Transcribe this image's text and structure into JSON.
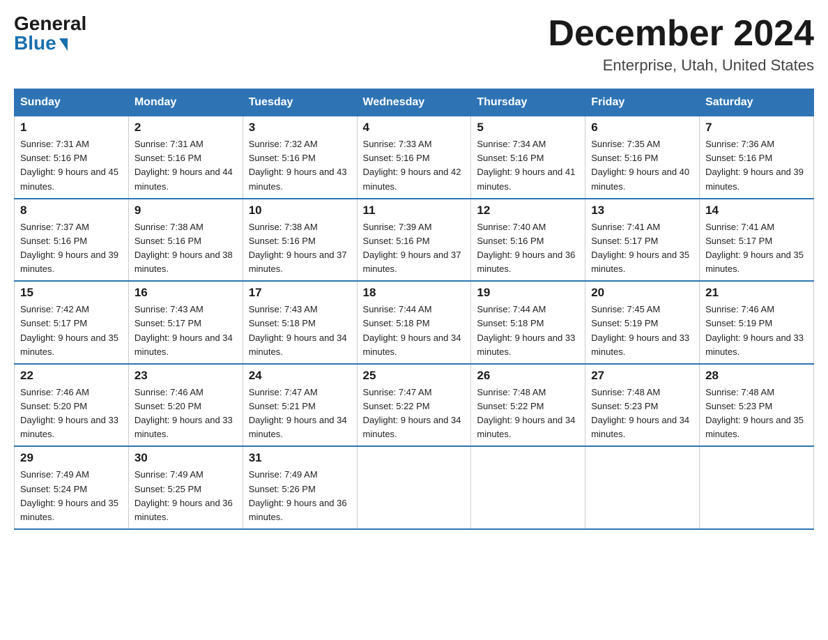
{
  "logo": {
    "general": "General",
    "blue": "Blue"
  },
  "title": "December 2024",
  "location": "Enterprise, Utah, United States",
  "days_of_week": [
    "Sunday",
    "Monday",
    "Tuesday",
    "Wednesday",
    "Thursday",
    "Friday",
    "Saturday"
  ],
  "weeks": [
    [
      {
        "day": 1,
        "sunrise": "7:31 AM",
        "sunset": "5:16 PM",
        "daylight": "9 hours and 45 minutes."
      },
      {
        "day": 2,
        "sunrise": "7:31 AM",
        "sunset": "5:16 PM",
        "daylight": "9 hours and 44 minutes."
      },
      {
        "day": 3,
        "sunrise": "7:32 AM",
        "sunset": "5:16 PM",
        "daylight": "9 hours and 43 minutes."
      },
      {
        "day": 4,
        "sunrise": "7:33 AM",
        "sunset": "5:16 PM",
        "daylight": "9 hours and 42 minutes."
      },
      {
        "day": 5,
        "sunrise": "7:34 AM",
        "sunset": "5:16 PM",
        "daylight": "9 hours and 41 minutes."
      },
      {
        "day": 6,
        "sunrise": "7:35 AM",
        "sunset": "5:16 PM",
        "daylight": "9 hours and 40 minutes."
      },
      {
        "day": 7,
        "sunrise": "7:36 AM",
        "sunset": "5:16 PM",
        "daylight": "9 hours and 39 minutes."
      }
    ],
    [
      {
        "day": 8,
        "sunrise": "7:37 AM",
        "sunset": "5:16 PM",
        "daylight": "9 hours and 39 minutes."
      },
      {
        "day": 9,
        "sunrise": "7:38 AM",
        "sunset": "5:16 PM",
        "daylight": "9 hours and 38 minutes."
      },
      {
        "day": 10,
        "sunrise": "7:38 AM",
        "sunset": "5:16 PM",
        "daylight": "9 hours and 37 minutes."
      },
      {
        "day": 11,
        "sunrise": "7:39 AM",
        "sunset": "5:16 PM",
        "daylight": "9 hours and 37 minutes."
      },
      {
        "day": 12,
        "sunrise": "7:40 AM",
        "sunset": "5:16 PM",
        "daylight": "9 hours and 36 minutes."
      },
      {
        "day": 13,
        "sunrise": "7:41 AM",
        "sunset": "5:17 PM",
        "daylight": "9 hours and 35 minutes."
      },
      {
        "day": 14,
        "sunrise": "7:41 AM",
        "sunset": "5:17 PM",
        "daylight": "9 hours and 35 minutes."
      }
    ],
    [
      {
        "day": 15,
        "sunrise": "7:42 AM",
        "sunset": "5:17 PM",
        "daylight": "9 hours and 35 minutes."
      },
      {
        "day": 16,
        "sunrise": "7:43 AM",
        "sunset": "5:17 PM",
        "daylight": "9 hours and 34 minutes."
      },
      {
        "day": 17,
        "sunrise": "7:43 AM",
        "sunset": "5:18 PM",
        "daylight": "9 hours and 34 minutes."
      },
      {
        "day": 18,
        "sunrise": "7:44 AM",
        "sunset": "5:18 PM",
        "daylight": "9 hours and 34 minutes."
      },
      {
        "day": 19,
        "sunrise": "7:44 AM",
        "sunset": "5:18 PM",
        "daylight": "9 hours and 33 minutes."
      },
      {
        "day": 20,
        "sunrise": "7:45 AM",
        "sunset": "5:19 PM",
        "daylight": "9 hours and 33 minutes."
      },
      {
        "day": 21,
        "sunrise": "7:46 AM",
        "sunset": "5:19 PM",
        "daylight": "9 hours and 33 minutes."
      }
    ],
    [
      {
        "day": 22,
        "sunrise": "7:46 AM",
        "sunset": "5:20 PM",
        "daylight": "9 hours and 33 minutes."
      },
      {
        "day": 23,
        "sunrise": "7:46 AM",
        "sunset": "5:20 PM",
        "daylight": "9 hours and 33 minutes."
      },
      {
        "day": 24,
        "sunrise": "7:47 AM",
        "sunset": "5:21 PM",
        "daylight": "9 hours and 34 minutes."
      },
      {
        "day": 25,
        "sunrise": "7:47 AM",
        "sunset": "5:22 PM",
        "daylight": "9 hours and 34 minutes."
      },
      {
        "day": 26,
        "sunrise": "7:48 AM",
        "sunset": "5:22 PM",
        "daylight": "9 hours and 34 minutes."
      },
      {
        "day": 27,
        "sunrise": "7:48 AM",
        "sunset": "5:23 PM",
        "daylight": "9 hours and 34 minutes."
      },
      {
        "day": 28,
        "sunrise": "7:48 AM",
        "sunset": "5:23 PM",
        "daylight": "9 hours and 35 minutes."
      }
    ],
    [
      {
        "day": 29,
        "sunrise": "7:49 AM",
        "sunset": "5:24 PM",
        "daylight": "9 hours and 35 minutes."
      },
      {
        "day": 30,
        "sunrise": "7:49 AM",
        "sunset": "5:25 PM",
        "daylight": "9 hours and 36 minutes."
      },
      {
        "day": 31,
        "sunrise": "7:49 AM",
        "sunset": "5:26 PM",
        "daylight": "9 hours and 36 minutes."
      },
      null,
      null,
      null,
      null
    ]
  ]
}
